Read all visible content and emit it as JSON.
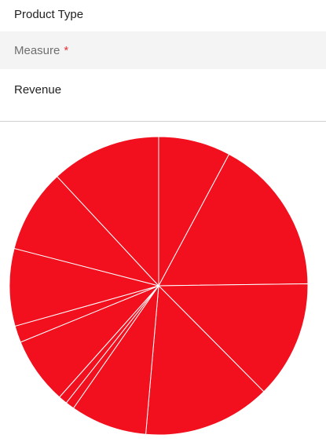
{
  "form": {
    "product_type_label": "Product Type",
    "measure_label": "Measure",
    "required_marker": "*",
    "measure_value": "Revenue"
  },
  "colors": {
    "slice_fill": "#f20f1e",
    "slice_stroke": "#ffffff"
  },
  "chart_data": {
    "type": "pie",
    "values": [
      8.2,
      17.8,
      13.4,
      14.5,
      8.7,
      1.0,
      1.0,
      7.6,
      1.9,
      8.8,
      9.5,
      12.5
    ]
  }
}
